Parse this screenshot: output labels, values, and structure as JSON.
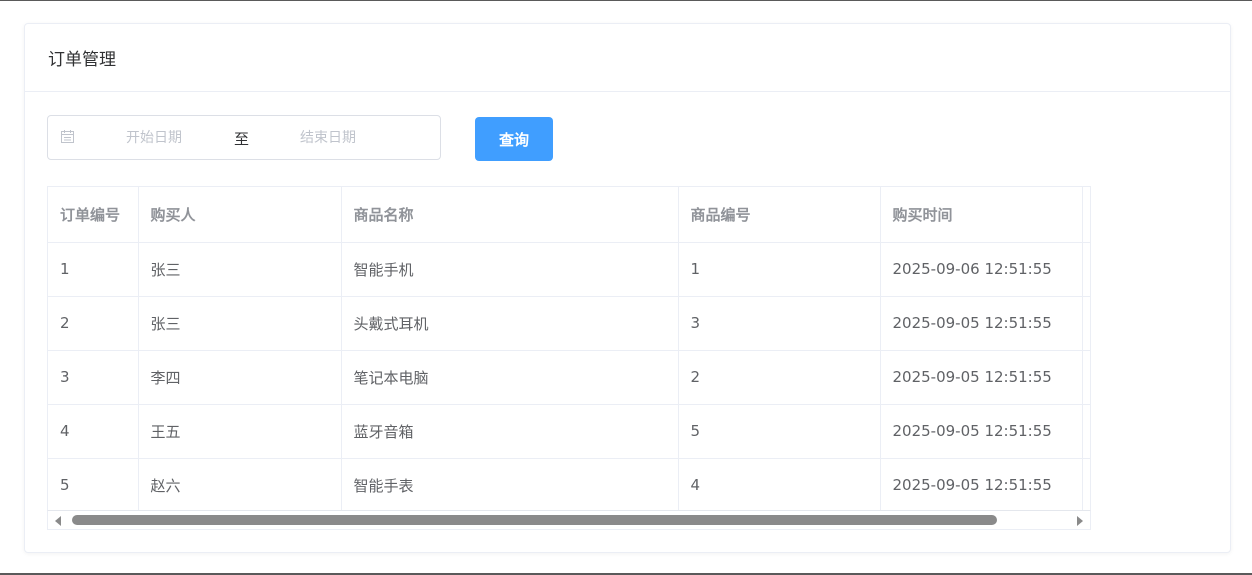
{
  "card": {
    "title": "订单管理"
  },
  "filter": {
    "start_placeholder": "开始日期",
    "separator": "至",
    "end_placeholder": "结束日期",
    "query_label": "查询"
  },
  "table": {
    "headers": [
      "订单编号",
      "购买人",
      "商品名称",
      "商品编号",
      "购买时间"
    ],
    "rows": [
      [
        "1",
        "张三",
        "智能手机",
        "1",
        "2025-09-06 12:51:55"
      ],
      [
        "2",
        "张三",
        "头戴式耳机",
        "3",
        "2025-09-05 12:51:55"
      ],
      [
        "3",
        "李四",
        "笔记本电脑",
        "2",
        "2025-09-05 12:51:55"
      ],
      [
        "4",
        "王五",
        "蓝牙音箱",
        "5",
        "2025-09-05 12:51:55"
      ],
      [
        "5",
        "赵六",
        "智能手表",
        "4",
        "2025-09-05 12:51:55"
      ]
    ]
  },
  "icons": {
    "date": "calendar-icon",
    "scroll_left": "arrow-left-icon",
    "scroll_right": "arrow-right-icon"
  },
  "colors": {
    "primary": "#409eff",
    "border": "#ebeef5",
    "header_text": "#909399",
    "cell_text": "#606266",
    "placeholder": "#c0c4cc"
  }
}
